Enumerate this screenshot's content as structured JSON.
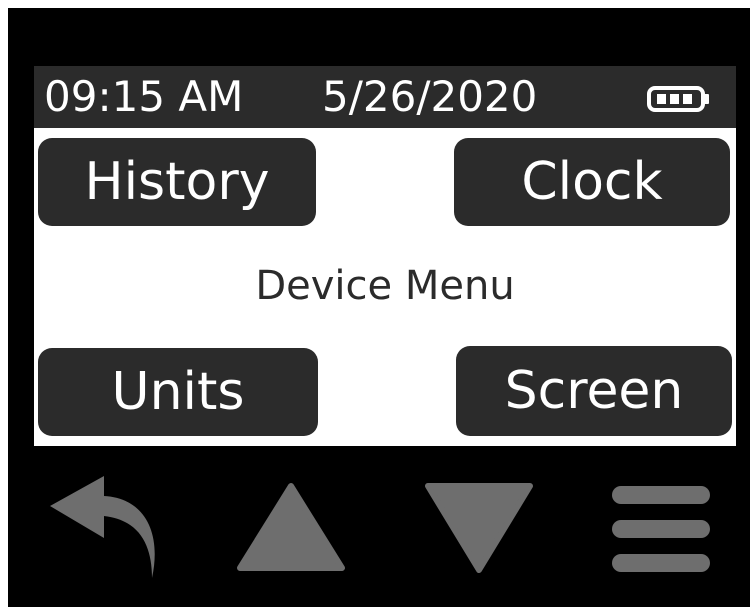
{
  "status_bar": {
    "time": "09:15 AM",
    "date": "5/26/2020",
    "battery_icon": "battery-full-icon"
  },
  "menu": {
    "title": "Device Menu",
    "buttons": {
      "history": "History",
      "clock": "Clock",
      "units": "Units",
      "screen": "Screen"
    }
  },
  "nav": {
    "icons": [
      "back-arrow-icon",
      "up-arrow-icon",
      "down-arrow-icon",
      "menu-icon"
    ]
  },
  "colors": {
    "bezel": "#000000",
    "panel": "#2b2b2b",
    "screen_bg": "#ffffff",
    "nav_icon": "#6e6e6e"
  }
}
